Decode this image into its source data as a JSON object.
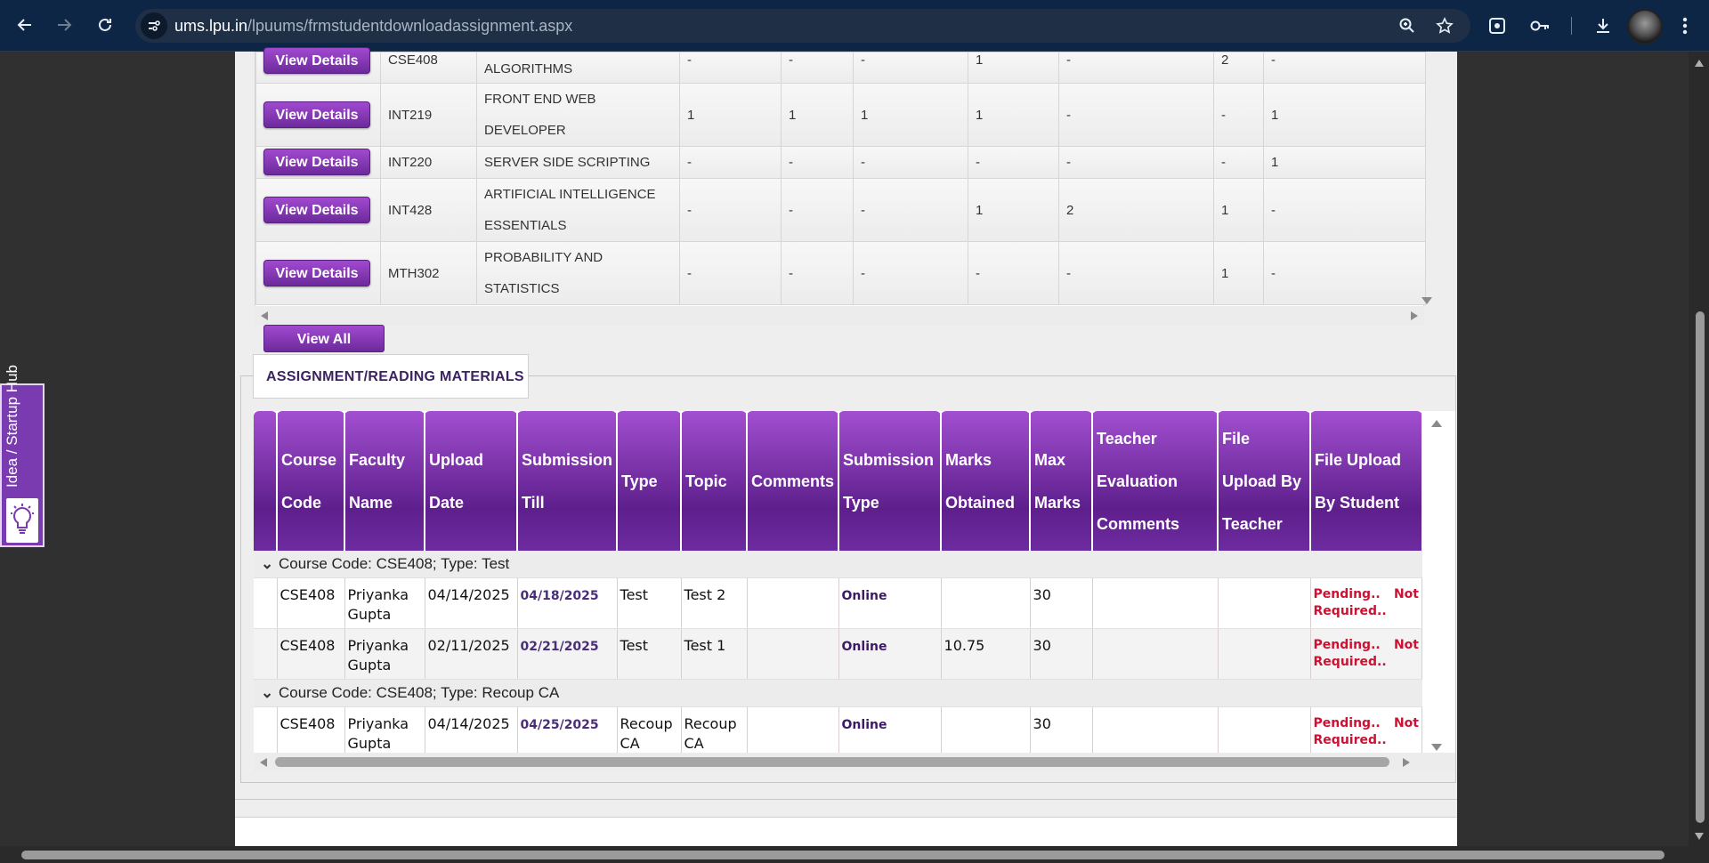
{
  "browser": {
    "url_host": "ums.lpu.in",
    "url_path": "/lpuums/frmstudentdownloadassignment.aspx",
    "icons": [
      "back-icon",
      "forward-icon",
      "reload-icon",
      "site-info-icon",
      "zoom-icon",
      "star-icon",
      "screenshot-icon",
      "password-key-icon",
      "download-icon",
      "profile-avatar",
      "menu-icon"
    ]
  },
  "top_table": {
    "button_label": "View Details",
    "rows": [
      {
        "code": "CSE408",
        "name": "ALGORITHMS",
        "c1": "-",
        "c2": "-",
        "c3": "-",
        "c4": "1",
        "c5": "-",
        "c6": "2",
        "c7": "-"
      },
      {
        "code": "INT219",
        "name": "FRONT END WEB DEVELOPER",
        "c1": "1",
        "c2": "1",
        "c3": "1",
        "c4": "1",
        "c5": "-",
        "c6": "-",
        "c7": "1"
      },
      {
        "code": "INT220",
        "name": "SERVER SIDE SCRIPTING",
        "c1": "-",
        "c2": "-",
        "c3": "-",
        "c4": "-",
        "c5": "-",
        "c6": "-",
        "c7": "1"
      },
      {
        "code": "INT428",
        "name": "ARTIFICIAL INTELLIGENCE ESSENTIALS",
        "c1": "-",
        "c2": "-",
        "c3": "-",
        "c4": "1",
        "c5": "2",
        "c6": "1",
        "c7": "-"
      },
      {
        "code": "MTH302",
        "name": "PROBABILITY AND STATISTICS",
        "c1": "-",
        "c2": "-",
        "c3": "-",
        "c4": "-",
        "c5": "-",
        "c6": "1",
        "c7": "-"
      }
    ]
  },
  "view_all_label": "View All",
  "section_title": "ASSIGNMENT/READING MATERIALS",
  "grid": {
    "headers": [
      "Course Code",
      "Faculty Name",
      "Upload Date",
      "Submission Till",
      "Type",
      "Topic",
      "Comments",
      "Submission Type",
      "Marks Obtained",
      "Max Marks",
      "Teacher Evaluation Comments",
      "File Upload By Teacher",
      "File Upload By Student"
    ],
    "groups": [
      {
        "label": "Course Code: CSE408; Type: Test",
        "rows": [
          {
            "code": "CSE408",
            "faculty": "Priyanka Gupta",
            "upload": "04/14/2025",
            "till": "04/18/2025",
            "type": "Test",
            "topic": "Test 2",
            "comments": "",
            "sub_type": "Online",
            "marks": "",
            "max": "30",
            "teacher_comments": "",
            "teacher_upload": "",
            "student_upload": "Pending..",
            "student_upload_2": "Not Required.."
          },
          {
            "code": "CSE408",
            "faculty": "Priyanka Gupta",
            "upload": "02/11/2025",
            "till": "02/21/2025",
            "type": "Test",
            "topic": "Test 1",
            "comments": "",
            "sub_type": "Online",
            "marks": "10.75",
            "max": "30",
            "teacher_comments": "",
            "teacher_upload": "",
            "student_upload": "Pending..",
            "student_upload_2": "Not Required.."
          }
        ]
      },
      {
        "label": "Course Code: CSE408; Type: Recoup CA",
        "rows": [
          {
            "code": "CSE408",
            "faculty": "Priyanka Gupta",
            "upload": "04/14/2025",
            "till": "04/25/2025",
            "type": "Recoup CA",
            "topic": "Recoup CA",
            "comments": "",
            "sub_type": "Online",
            "marks": "",
            "max": "30",
            "teacher_comments": "",
            "teacher_upload": "",
            "student_upload": "Pending..",
            "student_upload_2": "Not Required.."
          }
        ]
      }
    ]
  },
  "side_tab": {
    "label": "Idea / Startup Hub",
    "icon": "lightbulb-icon"
  },
  "colors": {
    "accent_purple": "#7a3bb0",
    "pending_red": "#cc1133",
    "chrome_blue": "#0d2646"
  }
}
